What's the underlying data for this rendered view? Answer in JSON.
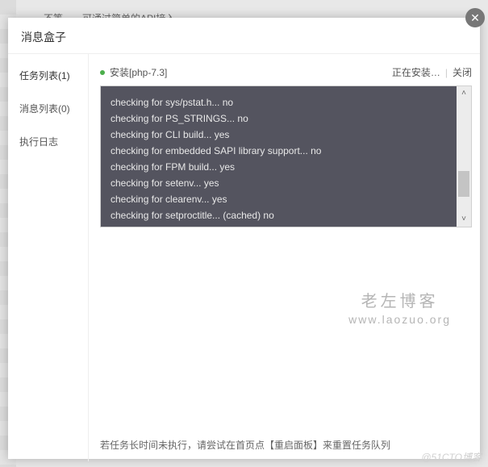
{
  "background": {
    "partial_text": "……不等……可通过简单的API接入"
  },
  "modal": {
    "title": "消息盒子",
    "sidebar": {
      "items": [
        {
          "label": "任务列表(1)",
          "active": true
        },
        {
          "label": "消息列表(0)",
          "active": false
        },
        {
          "label": "执行日志",
          "active": false
        }
      ]
    },
    "task": {
      "name": "安装[php-7.3]",
      "status": "正在安装…",
      "close_label": "关闭"
    },
    "console_lines": [
      "checking for sys/pstat.h... no",
      "checking for PS_STRINGS... no",
      "checking for CLI build... yes",
      "checking for embedded SAPI library support... no",
      "checking for FPM build... yes",
      "checking for setenv... yes",
      "checking for clearenv... yes",
      "checking for setproctitle... (cached) no"
    ],
    "footer_tip": "若任务长时间未执行，请尝试在首页点【重启面板】来重置任务队列"
  },
  "watermark": {
    "cn": "老左博客",
    "en": "www.laozuo.org"
  },
  "outer_watermark": "@51CTO博客"
}
